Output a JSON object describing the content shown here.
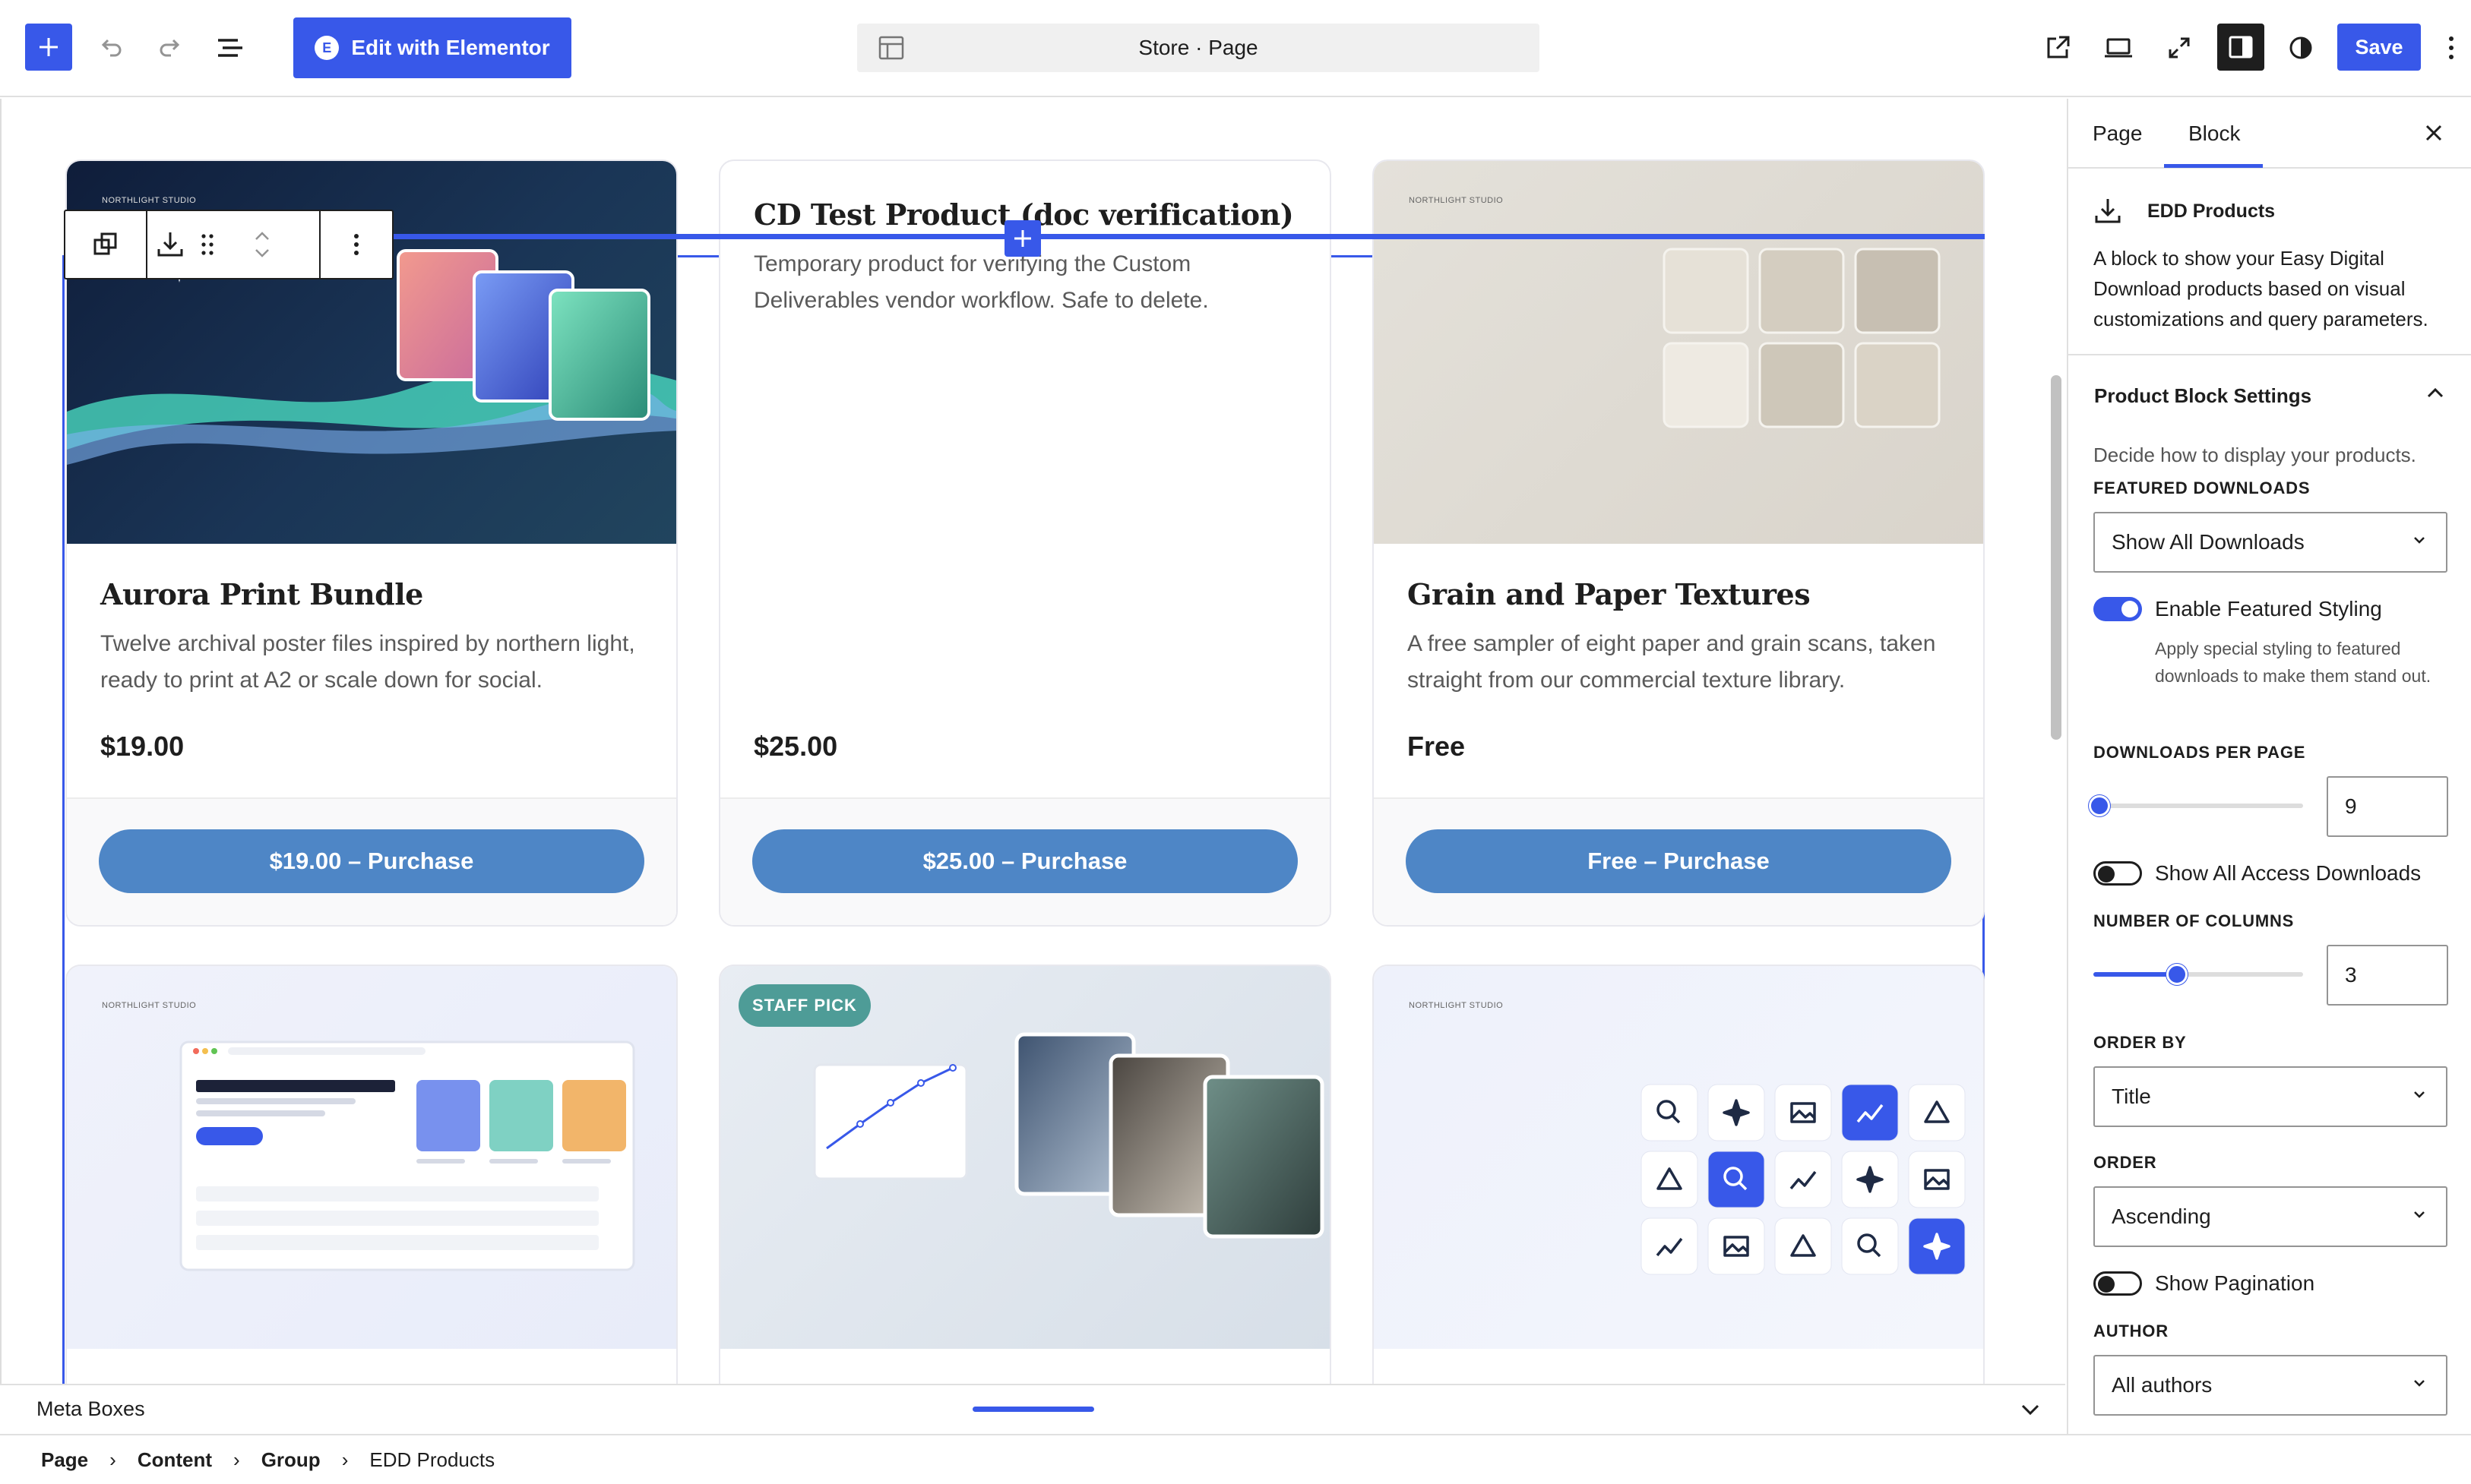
{
  "topbar": {
    "elementor_label": "Edit with Elementor",
    "elementor_badge": "E",
    "doc_title": "Store · Page",
    "save_label": "Save"
  },
  "colors": {
    "accent": "#3858e9",
    "button": "#4e86c6",
    "badge": "#4e9c97"
  },
  "products": [
    {
      "title": "Aurora Print Bundle",
      "desc": "Twelve archival poster files inspired by northern light, ready to print at A2 or scale down for social.",
      "price": "$19.00",
      "button": "$19.00 – Purchase",
      "brand": "NORTHLIGHT STUDIO"
    },
    {
      "title": "CD Test Product (doc verification)",
      "desc": "Temporary product for verifying the Custom Deliverables vendor workflow. Safe to delete.",
      "price": "$25.00",
      "button": "$25.00 – Purchase"
    },
    {
      "title": "Grain and Paper Textures",
      "desc": "A free sampler of eight paper and grain scans, taken straight from our commercial texture library.",
      "price": "Free",
      "button": "Free – Purchase",
      "brand": "NORTHLIGHT STUDIO"
    },
    {
      "brand": "NORTHLIGHT STUDIO"
    },
    {
      "badge": "STAFF PICK"
    },
    {
      "brand": "NORTHLIGHT STUDIO"
    }
  ],
  "metabox": {
    "label": "Meta Boxes"
  },
  "breadcrumb": [
    "Page",
    "Content",
    "Group",
    "EDD Products"
  ],
  "sidebar": {
    "tab_page": "Page",
    "tab_block": "Block",
    "block_name": "EDD Products",
    "block_desc": "A block to show your Easy Digital Download products based on visual customizations and query parameters.",
    "panel_title": "Product Block Settings",
    "panel_desc": "Decide how to display your products.",
    "featured_label": "FEATURED DOWNLOADS",
    "featured_value": "Show All Downloads",
    "featured_styling_label": "Enable Featured Styling",
    "featured_styling_on": true,
    "featured_styling_help": "Apply special styling to featured downloads to make them stand out.",
    "per_page_label": "DOWNLOADS PER PAGE",
    "per_page_value": "9",
    "per_page_fraction": 0.03,
    "all_access_label": "Show All Access Downloads",
    "all_access_on": false,
    "columns_label": "NUMBER OF COLUMNS",
    "columns_value": "3",
    "columns_fraction": 0.4,
    "orderby_label": "ORDER BY",
    "orderby_value": "Title",
    "order_label": "ORDER",
    "order_value": "Ascending",
    "pagination_label": "Show Pagination",
    "pagination_on": false,
    "author_label": "AUTHOR",
    "author_value": "All authors"
  }
}
